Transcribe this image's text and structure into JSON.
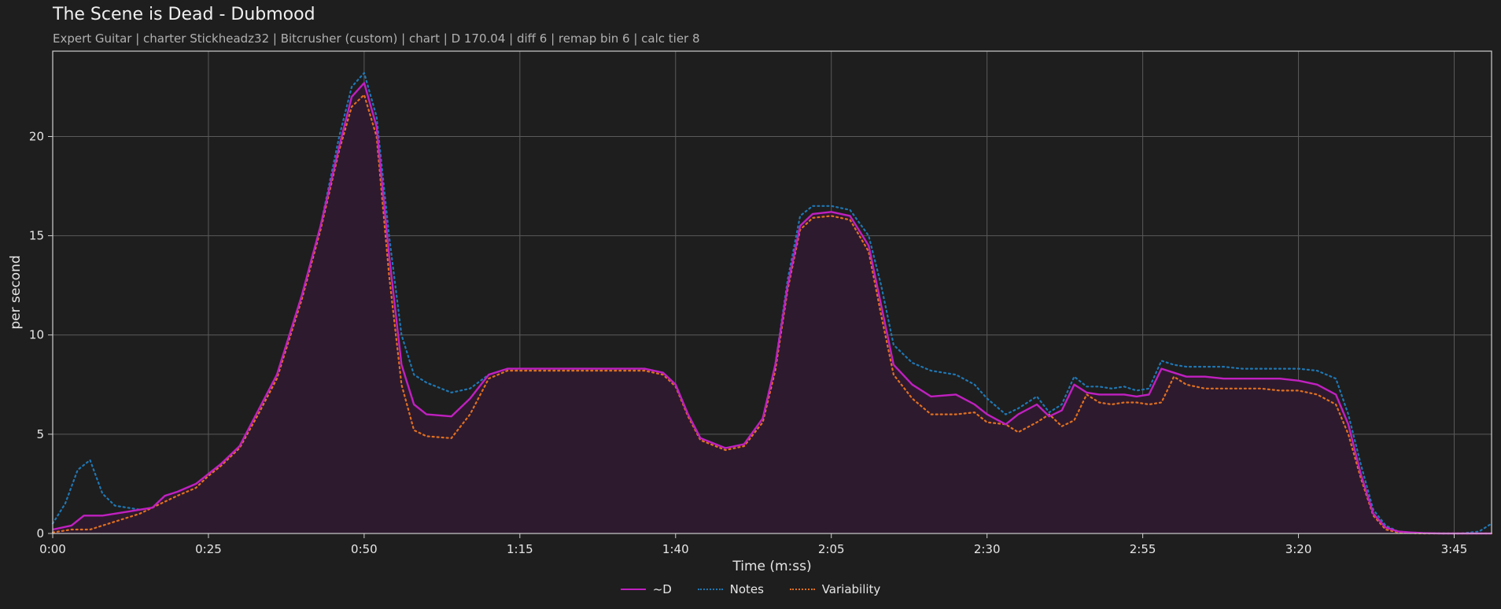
{
  "title": "The Scene is Dead - Dubmood",
  "subtitle": "Expert Guitar  |  charter Stickheadz32  |  Bitcrusher (custom)  |  chart  |  D 170.04  |  diff 6  |  remap bin 6  |  calc tier 8",
  "colors": {
    "background": "#1e1e1e",
    "grid": "#5a5a5a",
    "axis": "#cfcfcf",
    "d": "#c020c0",
    "notes": "#1f77b4",
    "variability": "#e07020",
    "fill": "#2e1a2e"
  },
  "chart_data": {
    "type": "line",
    "xlabel": "Time (m:ss)",
    "ylabel": "per second",
    "xlim": [
      0,
      231
    ],
    "ylim": [
      0,
      24.3
    ],
    "grid": true,
    "legend_position": "bottom-center",
    "x_ticks": [
      0,
      25,
      50,
      75,
      100,
      125,
      150,
      175,
      200,
      225
    ],
    "x_tick_labels": [
      "0:00",
      "0:25",
      "0:50",
      "1:15",
      "1:40",
      "2:05",
      "2:30",
      "2:55",
      "3:20",
      "3:45"
    ],
    "y_ticks": [
      0,
      5,
      10,
      15,
      20
    ],
    "y_tick_labels": [
      "0",
      "5",
      "10",
      "15",
      "20"
    ],
    "series": [
      {
        "name": "~D",
        "style": "solid",
        "x": [
          0,
          3,
          5,
          8,
          12,
          16,
          18,
          20,
          23,
          25,
          27,
          30,
          33,
          36,
          40,
          43,
          46,
          48,
          50,
          52,
          54,
          56,
          58,
          60,
          64,
          67,
          70,
          73,
          75,
          80,
          85,
          90,
          95,
          98,
          100,
          102,
          104,
          108,
          111,
          114,
          116,
          118,
          120,
          122,
          125,
          128,
          131,
          133,
          135,
          138,
          141,
          145,
          148,
          150,
          153,
          155,
          158,
          160,
          162,
          164,
          166,
          168,
          170,
          172,
          174,
          176,
          178,
          180,
          182,
          185,
          188,
          191,
          194,
          197,
          200,
          203,
          206,
          208,
          210,
          212,
          214,
          216,
          218,
          220,
          223,
          226,
          229,
          231
        ],
        "values": [
          0.2,
          0.4,
          0.9,
          0.9,
          1.1,
          1.3,
          1.9,
          2.1,
          2.5,
          3.0,
          3.5,
          4.4,
          6.2,
          8.0,
          12.0,
          15.5,
          19.5,
          22.0,
          22.7,
          20.5,
          14.0,
          8.5,
          6.5,
          6.0,
          5.9,
          6.8,
          8.0,
          8.3,
          8.3,
          8.3,
          8.3,
          8.3,
          8.3,
          8.1,
          7.5,
          6.0,
          4.8,
          4.3,
          4.5,
          5.8,
          8.5,
          12.5,
          15.5,
          16.1,
          16.2,
          16.0,
          14.5,
          11.5,
          8.5,
          7.5,
          6.9,
          7.0,
          6.5,
          6.0,
          5.5,
          6.0,
          6.5,
          5.9,
          6.2,
          7.5,
          7.1,
          7.0,
          7.0,
          7.0,
          6.9,
          7.0,
          8.3,
          8.1,
          7.9,
          7.9,
          7.8,
          7.8,
          7.8,
          7.8,
          7.7,
          7.5,
          7.0,
          5.5,
          3.0,
          1.0,
          0.3,
          0.1,
          0.05,
          0.02,
          0.0,
          0.0,
          0.0,
          0.0
        ]
      },
      {
        "name": "Notes",
        "style": "dotted",
        "x": [
          0,
          2,
          4,
          6,
          8,
          10,
          12,
          14,
          16,
          18,
          20,
          23,
          25,
          27,
          30,
          33,
          36,
          40,
          43,
          46,
          48,
          50,
          52,
          54,
          56,
          58,
          60,
          64,
          67,
          70,
          73,
          75,
          80,
          85,
          90,
          95,
          98,
          100,
          102,
          104,
          108,
          111,
          114,
          116,
          118,
          120,
          122,
          125,
          128,
          131,
          133,
          135,
          138,
          141,
          145,
          148,
          150,
          153,
          155,
          158,
          160,
          162,
          164,
          166,
          168,
          170,
          172,
          174,
          176,
          178,
          180,
          182,
          185,
          188,
          191,
          194,
          197,
          200,
          203,
          206,
          208,
          210,
          212,
          214,
          216,
          218,
          220,
          223,
          226,
          229,
          231
        ],
        "values": [
          0.5,
          1.5,
          3.2,
          3.7,
          2.0,
          1.4,
          1.3,
          1.2,
          1.3,
          1.9,
          2.1,
          2.5,
          3.0,
          3.5,
          4.4,
          6.2,
          8.0,
          12.0,
          15.5,
          20.0,
          22.5,
          23.2,
          21.0,
          15.0,
          10.0,
          8.0,
          7.6,
          7.1,
          7.3,
          8.0,
          8.3,
          8.3,
          8.3,
          8.3,
          8.3,
          8.3,
          8.1,
          7.5,
          6.0,
          4.8,
          4.3,
          4.5,
          5.8,
          8.5,
          12.8,
          16.0,
          16.5,
          16.5,
          16.3,
          15.0,
          12.5,
          9.5,
          8.6,
          8.2,
          8.0,
          7.5,
          6.8,
          6.0,
          6.3,
          6.9,
          6.1,
          6.5,
          7.9,
          7.4,
          7.4,
          7.3,
          7.4,
          7.2,
          7.3,
          8.7,
          8.5,
          8.4,
          8.4,
          8.4,
          8.3,
          8.3,
          8.3,
          8.3,
          8.2,
          7.8,
          6.0,
          3.5,
          1.2,
          0.4,
          0.1,
          0.05,
          0.02,
          0.0,
          0.0,
          0.1,
          0.5
        ]
      },
      {
        "name": "Variability",
        "style": "dotted",
        "x": [
          0,
          3,
          6,
          10,
          14,
          18,
          20,
          23,
          25,
          27,
          30,
          33,
          36,
          40,
          43,
          46,
          48,
          50,
          52,
          54,
          56,
          58,
          60,
          64,
          67,
          70,
          73,
          75,
          80,
          85,
          90,
          95,
          98,
          100,
          102,
          104,
          108,
          111,
          114,
          116,
          118,
          120,
          122,
          125,
          128,
          131,
          133,
          135,
          138,
          141,
          145,
          148,
          150,
          153,
          155,
          158,
          160,
          162,
          164,
          166,
          168,
          170,
          172,
          174,
          176,
          178,
          180,
          182,
          185,
          188,
          191,
          194,
          197,
          200,
          203,
          206,
          208,
          210,
          212,
          214,
          216,
          218,
          220,
          223,
          226,
          229,
          231
        ],
        "values": [
          0.05,
          0.2,
          0.2,
          0.6,
          1.0,
          1.6,
          1.9,
          2.3,
          2.9,
          3.4,
          4.3,
          6.0,
          7.8,
          11.8,
          15.3,
          19.3,
          21.5,
          22.1,
          20.0,
          13.0,
          7.5,
          5.2,
          4.9,
          4.8,
          6.0,
          7.8,
          8.2,
          8.2,
          8.2,
          8.2,
          8.2,
          8.2,
          8.0,
          7.4,
          5.9,
          4.7,
          4.2,
          4.4,
          5.6,
          8.2,
          12.3,
          15.3,
          15.9,
          16.0,
          15.8,
          14.2,
          11.0,
          8.0,
          6.8,
          6.0,
          6.0,
          6.1,
          5.6,
          5.5,
          5.1,
          5.6,
          6.0,
          5.4,
          5.7,
          7.0,
          6.6,
          6.5,
          6.6,
          6.6,
          6.5,
          6.6,
          7.9,
          7.5,
          7.3,
          7.3,
          7.3,
          7.3,
          7.2,
          7.2,
          7.0,
          6.5,
          5.0,
          2.8,
          0.9,
          0.2,
          0.05,
          0.02,
          0.0,
          0.0,
          0.0,
          0.0,
          0.0
        ]
      }
    ]
  }
}
